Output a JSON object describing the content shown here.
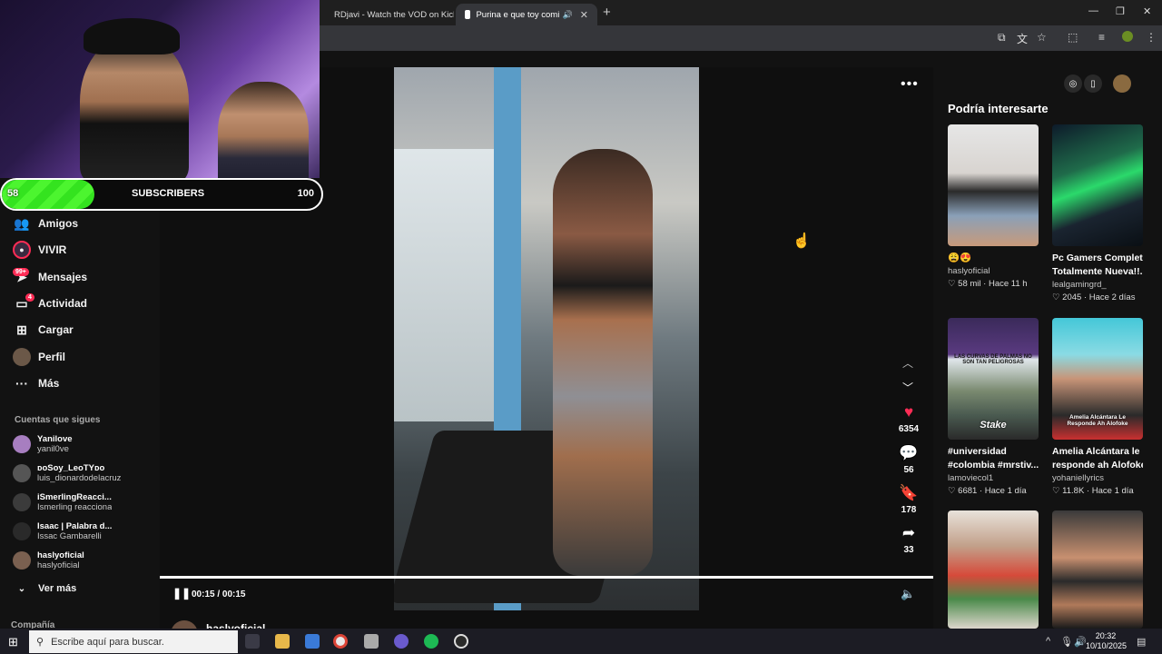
{
  "browser": {
    "tabs": [
      {
        "label": "RDjavi - Watch the VOD on Kick",
        "active": false,
        "icon_color": "#53fc18"
      },
      {
        "label": "Purina e que toy comiendo",
        "active": true,
        "icon_color": "#ffffff"
      }
    ],
    "new_tab_icon": "plus-icon",
    "window_controls": [
      "minimize-icon",
      "restore-icon",
      "close-icon"
    ]
  },
  "stream_overlay": {
    "sub_current": "58",
    "sub_label": "SUBSCRIBERS",
    "sub_goal": "100",
    "sub_progress": 0.58,
    "accent": "#34e31f"
  },
  "sidebar": {
    "items": [
      {
        "label": "Amigos",
        "icon": "friends-icon"
      },
      {
        "label": "VIVIR",
        "icon": "live-icon"
      },
      {
        "label": "Mensajes",
        "icon": "messages-icon",
        "badge": "99+"
      },
      {
        "label": "Actividad",
        "icon": "activity-icon",
        "badge": "4"
      },
      {
        "label": "Cargar",
        "icon": "upload-icon"
      },
      {
        "label": "Perfil",
        "icon": "profile-icon"
      },
      {
        "label": "Más",
        "icon": "more-icon"
      }
    ],
    "following_label": "Cuentas que sigues",
    "following": [
      {
        "name": "Yanilove",
        "user": "yanil0ve"
      },
      {
        "name": "ᴅᴏSoy_LeoTYᴅᴏ",
        "user": "luis_dionardodelacruz"
      },
      {
        "name": "iSmerlingReacci...",
        "user": "Ismerling reacciona"
      },
      {
        "name": "Isaac | Palabra d...",
        "user": "Issac Gambarelli"
      },
      {
        "name": "haslyoficial",
        "user": "haslyoficial"
      }
    ],
    "see_more": "Ver más",
    "company": "Compañía"
  },
  "player": {
    "current_time": "00:15 / 00:15",
    "progress": 1.0,
    "more_icon": "more-dots-icon",
    "author_peek": "haslyoficial",
    "actions": [
      {
        "icon": "heart-icon",
        "count": "6354",
        "color": "#fe2c55"
      },
      {
        "icon": "comment-icon",
        "count": "56",
        "color": "#ffffff"
      },
      {
        "icon": "bookmark-icon",
        "count": "178",
        "color": "#ffffff"
      },
      {
        "icon": "share-icon",
        "count": "33",
        "color": "#ffffff"
      }
    ]
  },
  "recommendations": {
    "title": "Podría interesarte",
    "cards": [
      {
        "caption": "😩😍",
        "user": "haslyoficial",
        "likes": "58 mil",
        "age": "Hace 11 h"
      },
      {
        "caption": "Pc Gamers Completa Totalmente Nueva!!...",
        "caption_line1": "Pc Gamers Completa",
        "caption_line2": "Totalmente Nueva!!...",
        "user": "lealgamingrd_",
        "likes": "2045",
        "age": "Hace 2 días"
      },
      {
        "caption_line1": "#universidad",
        "caption_line2": "#colombia #mrstiv...",
        "user": "lamoviecol1",
        "likes": "6681",
        "age": "Hace 1 día",
        "thumb_top_text": "LAS CURVAS DE PALMAS NO SON TAN PELIGROSAS",
        "thumb_brand": "Stake"
      },
      {
        "caption_line1": "Amelia Alcántara le",
        "caption_line2": "responde ah Alofoke",
        "user": "yohaniellyrics",
        "likes": "11.8K",
        "age": "Hace 1 día",
        "thumb_text": "Amelia Alcántara Le Responde Ah Alofoke"
      }
    ]
  },
  "taskbar": {
    "search_placeholder": "Escribe aquí para buscar.",
    "time": "20:32",
    "date": "10/10/2025"
  }
}
